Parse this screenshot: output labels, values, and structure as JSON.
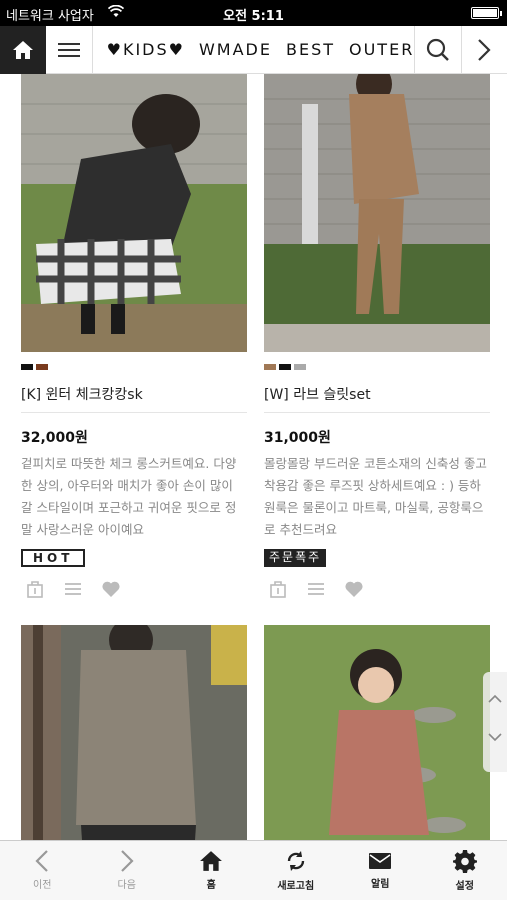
{
  "status": {
    "carrier": "네트워크 사업자",
    "time": "오전 5:11"
  },
  "nav": {
    "categories": [
      "♥KIDS♥",
      "WMADE",
      "BEST",
      "OUTER"
    ]
  },
  "products": [
    {
      "name": "[K] 윈터 체크캉캉sk",
      "price": "32,000원",
      "desc": "겉피치로 따뜻한 체크 롱스커트예요. 다양한 상의, 아우터와 매치가 좋아 손이 많이 갈 스타일이며 포근하고 귀여운 핏으로 정말 사랑스러운 아이예요",
      "badge": "HOT",
      "swatches": [
        "#111111",
        "#7a3b1e"
      ]
    },
    {
      "name": "[W] 라브 슬릿set",
      "price": "31,000원",
      "desc": "몰랑몰랑 부드러운 코튼소재의 신축성 좋고 착용감 좋은 루즈핏 상하세트예요 : ) 등하원룩은 물론이고 마트룩, 마실룩, 공항룩으로 추천드려요",
      "badge": "주문폭주",
      "swatches": [
        "#a07855",
        "#111111",
        "#aaaaaa"
      ]
    },
    {
      "name": "",
      "price": "",
      "desc": "",
      "badge": "",
      "swatches": []
    },
    {
      "name": "",
      "price": "",
      "desc": "",
      "badge": "",
      "swatches": []
    }
  ],
  "tabbar": {
    "prev": "이전",
    "next": "다음",
    "home": "홈",
    "refresh": "새로고침",
    "notice": "알림",
    "settings": "설정"
  },
  "colors": {
    "accent": "#222222",
    "muted": "#888888",
    "swatch_icon": "#bbbbbb"
  }
}
